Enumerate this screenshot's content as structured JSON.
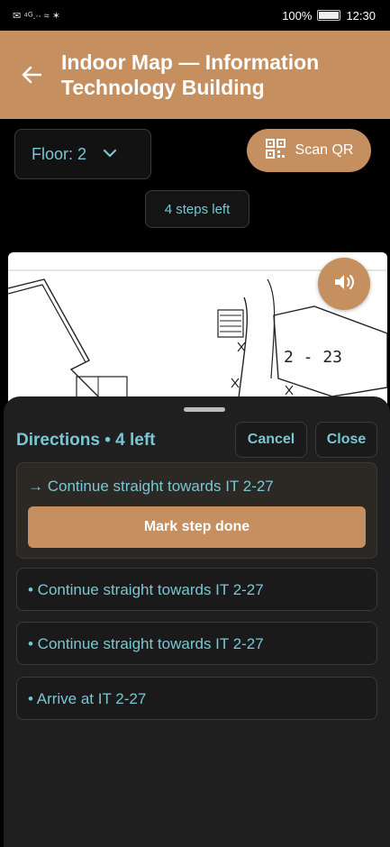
{
  "status_bar": {
    "left": "✉ ⁴ᴳ.∙∙ ≈ ✶",
    "battery": "100%",
    "time": "12:30"
  },
  "header": {
    "title": "Indoor Map — Information Technology Building"
  },
  "controls": {
    "floor_label": "Floor: 2",
    "scan_label": "Scan QR",
    "steps_pill": "4 steps left"
  },
  "map": {
    "room_label": "2 - 23"
  },
  "sheet": {
    "title": "Directions • 4 left",
    "cancel_label": "Cancel",
    "close_label": "Close",
    "active_step": "→  Continue straight towards IT 2-27",
    "mark_done_label": "Mark step done",
    "steps": [
      "•  Continue straight towards IT 2-27",
      "•  Continue straight towards IT 2-27",
      "•  Arrive at IT 2-27"
    ]
  },
  "colors": {
    "accent": "#c58f5f",
    "text_accent": "#79c7d3",
    "sheet_bg": "#1f1f1f"
  }
}
